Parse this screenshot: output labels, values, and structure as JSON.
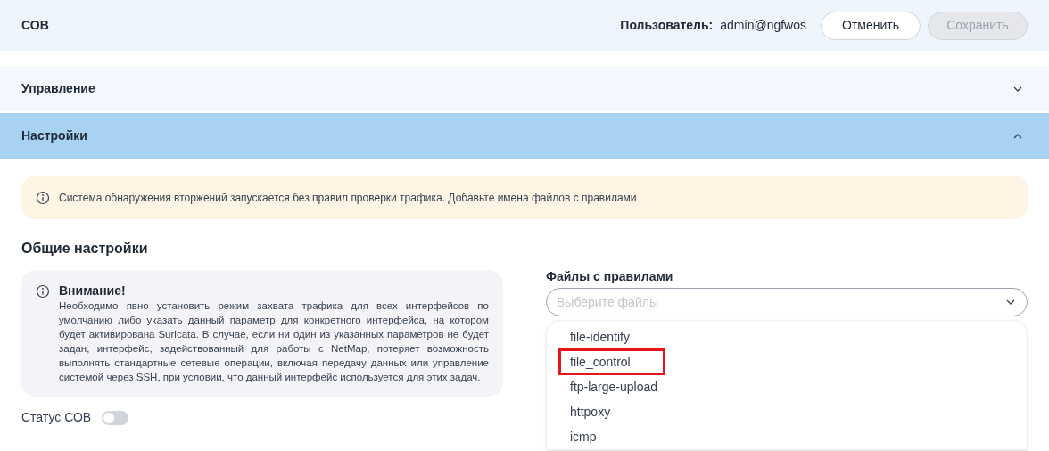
{
  "header": {
    "title": "СОВ",
    "user_label": "Пользователь:",
    "user": "admin@ngfwos",
    "buttons": [
      {
        "label": "Отменить",
        "disabled": false
      },
      {
        "label": "Сохранить",
        "disabled": true
      }
    ]
  },
  "sections": [
    {
      "title": "Управление",
      "expanded": false
    },
    {
      "title": "Настройки",
      "expanded": true
    }
  ],
  "alert": {
    "text": "Система обнаружения вторжений запускается без правил проверки трафика. Добавьте имена файлов с правилами"
  },
  "general": {
    "heading": "Общие настройки",
    "warning": {
      "title": "Внимание!",
      "text": "Необходимо явно установить режим захвата трафика для всех интерфейсов по умолчанию либо указать данный параметр для конкретного интерфейса, на котором будет активирована Suricata. В случае, если ни один из указанных параметров не будет задан, интерфейс, задействованный для работы с NetMap, потеряет возможность выполнять стандартные сетевые операции, включая передачу данных или управление системой через SSH, при условии, что данный интерфейс используется для этих задач."
    },
    "status": {
      "label": "Статус СОВ",
      "on": false
    }
  },
  "rules_files": {
    "label": "Файлы с правилами",
    "placeholder": "Выберите файлы",
    "options": [
      {
        "label": "file-identify",
        "highlighted": false
      },
      {
        "label": "file_control",
        "highlighted": true
      },
      {
        "label": "ftp-large-upload",
        "highlighted": false
      },
      {
        "label": "httpoxy",
        "highlighted": false
      },
      {
        "label": "icmp",
        "highlighted": false
      }
    ]
  }
}
